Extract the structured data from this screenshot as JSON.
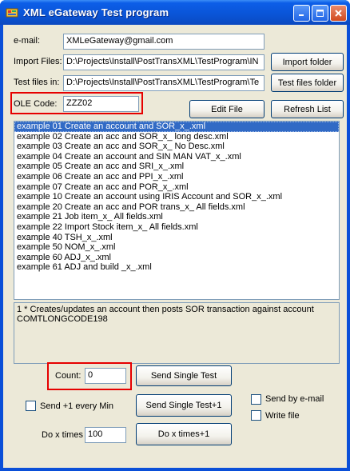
{
  "window": {
    "title": "XML eGateway Test program"
  },
  "form": {
    "email_label": "e-mail:",
    "email_value": "XMLeGateway@gmail.com",
    "import_label": "Import Files:",
    "import_value": "D:\\Projects\\Install\\PostTransXML\\TestProgram\\IN",
    "import_button": "Import folder",
    "testfiles_label": "Test files in:",
    "testfiles_value": "D:\\Projects\\Install\\PostTransXML\\TestProgram\\Te",
    "testfiles_button": "Test files folder",
    "ole_label": "OLE Code:",
    "ole_value": "ZZZ02",
    "edit_button": "Edit File",
    "refresh_button": "Refresh List"
  },
  "list": {
    "items": [
      "example 01 Create an account and SOR_x_.xml",
      "example 02 Create an acc and SOR_x_ long desc.xml",
      "example 03 Create an acc and SOR_x_ No Desc.xml",
      "example 04 Create an account and SIN MAN VAT_x_.xml",
      "example 05 Create an acc and SRI_x_.xml",
      "example 06 Create an acc and PPI_x_.xml",
      "example 07 Create an acc and POR_x_.xml",
      "example 10 Create an account using IRIS Account and SOR_x_.xml",
      "example 20 Create an acc and POR trans_x_ All fields.xml",
      "example 21 Job item_x_ All fields.xml",
      "example 22 Import Stock item_x_ All fields.xml",
      "example 40 TSH_x_.xml",
      "example 50 NOM_x_.xml",
      "example 60 ADJ_x_.xml",
      "example 61 ADJ and build _x_.xml"
    ],
    "selected_index": 0
  },
  "description": {
    "line1": "1 * Creates/updates an account then posts SOR transaction against account",
    "line2": "COMTLONGCODE198"
  },
  "controls": {
    "count_label": "Count:",
    "count_value": "0",
    "send_single_button": "Send Single Test",
    "send_plus1_label": "Send +1 every Min",
    "send_single_plus1_button": "Send Single Test+1",
    "send_email_label": "Send by e-mail",
    "write_file_label": "Write file",
    "dox_label": "Do x times",
    "dox_value": "100",
    "dox_button": "Do x times+1"
  },
  "colors": {
    "highlight_box": "#e60000",
    "selection": "#316ac5",
    "title_bar": "#0a54d6"
  }
}
